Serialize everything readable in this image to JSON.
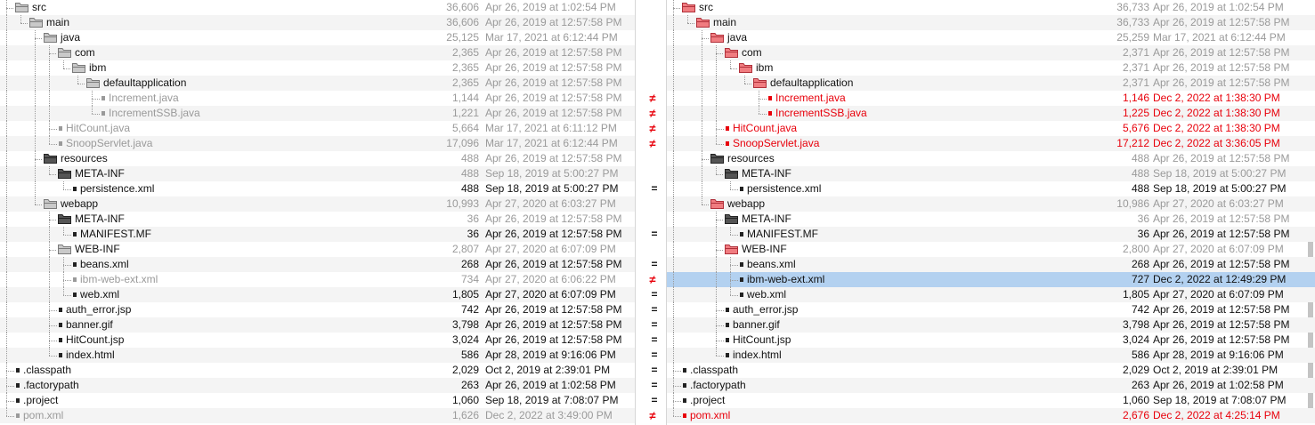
{
  "colors": {
    "diff": "#e8000b",
    "muted": "#9a9a9a",
    "selection": "#b3d1f0",
    "stripe": "#f4f4f4"
  },
  "rows": [
    {
      "level": 1,
      "type": "dir",
      "status": "same",
      "left": {
        "name": "src",
        "size": "36,606",
        "date": "Apr 26, 2019 at 1:02:54 PM"
      },
      "right": {
        "name": "src",
        "size": "36,733",
        "date": "Apr 26, 2019 at 1:02:54 PM"
      },
      "mark": ""
    },
    {
      "level": 2,
      "type": "dir",
      "status": "same",
      "left": {
        "name": "main",
        "size": "36,606",
        "date": "Apr 26, 2019 at 12:57:58 PM"
      },
      "right": {
        "name": "main",
        "size": "36,733",
        "date": "Apr 26, 2019 at 12:57:58 PM"
      },
      "mark": ""
    },
    {
      "level": 3,
      "type": "dir",
      "status": "same",
      "left": {
        "name": "java",
        "size": "25,125",
        "date": "Mar 17, 2021 at 6:12:44 PM"
      },
      "right": {
        "name": "java",
        "size": "25,259",
        "date": "Mar 17, 2021 at 6:12:44 PM"
      },
      "mark": ""
    },
    {
      "level": 4,
      "type": "dir",
      "status": "same",
      "left": {
        "name": "com",
        "size": "2,365",
        "date": "Apr 26, 2019 at 12:57:58 PM"
      },
      "right": {
        "name": "com",
        "size": "2,371",
        "date": "Apr 26, 2019 at 12:57:58 PM"
      },
      "mark": ""
    },
    {
      "level": 5,
      "type": "dir",
      "status": "same",
      "left": {
        "name": "ibm",
        "size": "2,365",
        "date": "Apr 26, 2019 at 12:57:58 PM"
      },
      "right": {
        "name": "ibm",
        "size": "2,371",
        "date": "Apr 26, 2019 at 12:57:58 PM"
      },
      "mark": ""
    },
    {
      "level": 6,
      "type": "dir",
      "status": "same",
      "left": {
        "name": "defaultapplication",
        "size": "2,365",
        "date": "Apr 26, 2019 at 12:57:58 PM"
      },
      "right": {
        "name": "defaultapplication",
        "size": "2,371",
        "date": "Apr 26, 2019 at 12:57:58 PM"
      },
      "mark": ""
    },
    {
      "level": 7,
      "type": "file",
      "status": "diff",
      "left": {
        "name": "Increment.java",
        "size": "1,144",
        "date": "Apr 26, 2019 at 12:57:58 PM"
      },
      "right": {
        "name": "Increment.java",
        "size": "1,146",
        "date": "Dec 2, 2022 at 1:38:30 PM"
      },
      "mark": "≠"
    },
    {
      "level": 7,
      "type": "file",
      "status": "diff",
      "left": {
        "name": "IncrementSSB.java",
        "size": "1,221",
        "date": "Apr 26, 2019 at 12:57:58 PM"
      },
      "right": {
        "name": "IncrementSSB.java",
        "size": "1,225",
        "date": "Dec 2, 2022 at 1:38:30 PM"
      },
      "mark": "≠"
    },
    {
      "level": 4,
      "type": "file",
      "status": "diff",
      "left": {
        "name": "HitCount.java",
        "size": "5,664",
        "date": "Mar 17, 2021 at 6:11:12 PM"
      },
      "right": {
        "name": "HitCount.java",
        "size": "5,676",
        "date": "Dec 2, 2022 at 1:38:30 PM"
      },
      "mark": "≠"
    },
    {
      "level": 4,
      "type": "file",
      "status": "diff",
      "left": {
        "name": "SnoopServlet.java",
        "size": "17,096",
        "date": "Mar 17, 2021 at 6:12:44 PM"
      },
      "right": {
        "name": "SnoopServlet.java",
        "size": "17,212",
        "date": "Dec 2, 2022 at 3:36:05 PM"
      },
      "mark": "≠"
    },
    {
      "level": 3,
      "type": "dir",
      "status": "same",
      "left": {
        "name": "resources",
        "size": "488",
        "date": "Apr 26, 2019 at 12:57:58 PM"
      },
      "right": {
        "name": "resources",
        "size": "488",
        "date": "Apr 26, 2019 at 12:57:58 PM"
      },
      "mark": ""
    },
    {
      "level": 4,
      "type": "dir",
      "status": "same",
      "left": {
        "name": "META-INF",
        "size": "488",
        "date": "Sep 18, 2019 at 5:00:27 PM"
      },
      "right": {
        "name": "META-INF",
        "size": "488",
        "date": "Sep 18, 2019 at 5:00:27 PM"
      },
      "mark": ""
    },
    {
      "level": 5,
      "type": "file",
      "status": "same",
      "left": {
        "name": "persistence.xml",
        "size": "488",
        "date": "Sep 18, 2019 at 5:00:27 PM"
      },
      "right": {
        "name": "persistence.xml",
        "size": "488",
        "date": "Sep 18, 2019 at 5:00:27 PM"
      },
      "mark": "="
    },
    {
      "level": 3,
      "type": "dir",
      "status": "same",
      "left": {
        "name": "webapp",
        "size": "10,993",
        "date": "Apr 27, 2020 at 6:03:27 PM"
      },
      "right": {
        "name": "webapp",
        "size": "10,986",
        "date": "Apr 27, 2020 at 6:03:27 PM"
      },
      "mark": ""
    },
    {
      "level": 4,
      "type": "dir",
      "status": "same",
      "left": {
        "name": "META-INF",
        "size": "36",
        "date": "Apr 26, 2019 at 12:57:58 PM"
      },
      "right": {
        "name": "META-INF",
        "size": "36",
        "date": "Apr 26, 2019 at 12:57:58 PM"
      },
      "mark": ""
    },
    {
      "level": 5,
      "type": "file",
      "status": "same",
      "left": {
        "name": "MANIFEST.MF",
        "size": "36",
        "date": "Apr 26, 2019 at 12:57:58 PM"
      },
      "right": {
        "name": "MANIFEST.MF",
        "size": "36",
        "date": "Apr 26, 2019 at 12:57:58 PM"
      },
      "mark": "="
    },
    {
      "level": 4,
      "type": "dir",
      "status": "same",
      "left": {
        "name": "WEB-INF",
        "size": "2,807",
        "date": "Apr 27, 2020 at 6:07:09 PM"
      },
      "right": {
        "name": "WEB-INF",
        "size": "2,800",
        "date": "Apr 27, 2020 at 6:07:09 PM"
      },
      "mark": ""
    },
    {
      "level": 5,
      "type": "file",
      "status": "same",
      "left": {
        "name": "beans.xml",
        "size": "268",
        "date": "Apr 26, 2019 at 12:57:58 PM"
      },
      "right": {
        "name": "beans.xml",
        "size": "268",
        "date": "Apr 26, 2019 at 12:57:58 PM"
      },
      "mark": "="
    },
    {
      "level": 5,
      "type": "file",
      "status": "seldiff",
      "left": {
        "name": "ibm-web-ext.xml",
        "size": "734",
        "date": "Apr 27, 2020 at 6:06:22 PM"
      },
      "right": {
        "name": "ibm-web-ext.xml",
        "size": "727",
        "date": "Dec 2, 2022 at 12:49:29 PM"
      },
      "mark": "≠"
    },
    {
      "level": 5,
      "type": "file",
      "status": "same",
      "left": {
        "name": "web.xml",
        "size": "1,805",
        "date": "Apr 27, 2020 at 6:07:09 PM"
      },
      "right": {
        "name": "web.xml",
        "size": "1,805",
        "date": "Apr 27, 2020 at 6:07:09 PM"
      },
      "mark": "="
    },
    {
      "level": 4,
      "type": "file",
      "status": "same",
      "left": {
        "name": "auth_error.jsp",
        "size": "742",
        "date": "Apr 26, 2019 at 12:57:58 PM"
      },
      "right": {
        "name": "auth_error.jsp",
        "size": "742",
        "date": "Apr 26, 2019 at 12:57:58 PM"
      },
      "mark": "="
    },
    {
      "level": 4,
      "type": "file",
      "status": "same",
      "left": {
        "name": "banner.gif",
        "size": "3,798",
        "date": "Apr 26, 2019 at 12:57:58 PM"
      },
      "right": {
        "name": "banner.gif",
        "size": "3,798",
        "date": "Apr 26, 2019 at 12:57:58 PM"
      },
      "mark": "="
    },
    {
      "level": 4,
      "type": "file",
      "status": "same",
      "left": {
        "name": "HitCount.jsp",
        "size": "3,024",
        "date": "Apr 26, 2019 at 12:57:58 PM"
      },
      "right": {
        "name": "HitCount.jsp",
        "size": "3,024",
        "date": "Apr 26, 2019 at 12:57:58 PM"
      },
      "mark": "="
    },
    {
      "level": 4,
      "type": "file",
      "status": "same",
      "left": {
        "name": "index.html",
        "size": "586",
        "date": "Apr 28, 2019 at 9:16:06 PM"
      },
      "right": {
        "name": "index.html",
        "size": "586",
        "date": "Apr 28, 2019 at 9:16:06 PM"
      },
      "mark": "="
    },
    {
      "level": 1,
      "type": "file",
      "status": "same",
      "left": {
        "name": ".classpath",
        "size": "2,029",
        "date": "Oct 2, 2019 at 2:39:01 PM"
      },
      "right": {
        "name": ".classpath",
        "size": "2,029",
        "date": "Oct 2, 2019 at 2:39:01 PM"
      },
      "mark": "="
    },
    {
      "level": 1,
      "type": "file",
      "status": "same",
      "left": {
        "name": ".factorypath",
        "size": "263",
        "date": "Apr 26, 2019 at 1:02:58 PM"
      },
      "right": {
        "name": ".factorypath",
        "size": "263",
        "date": "Apr 26, 2019 at 1:02:58 PM"
      },
      "mark": "="
    },
    {
      "level": 1,
      "type": "file",
      "status": "same",
      "left": {
        "name": ".project",
        "size": "1,060",
        "date": "Sep 18, 2019 at 7:08:07 PM"
      },
      "right": {
        "name": ".project",
        "size": "1,060",
        "date": "Sep 18, 2019 at 7:08:07 PM"
      },
      "mark": "="
    },
    {
      "level": 1,
      "type": "file",
      "status": "diff",
      "left": {
        "name": "pom.xml",
        "size": "1,626",
        "date": "Dec 2, 2022 at 3:49:00 PM"
      },
      "right": {
        "name": "pom.xml",
        "size": "2,676",
        "date": "Dec 2, 2022 at 4:25:14 PM"
      },
      "mark": "≠"
    }
  ]
}
